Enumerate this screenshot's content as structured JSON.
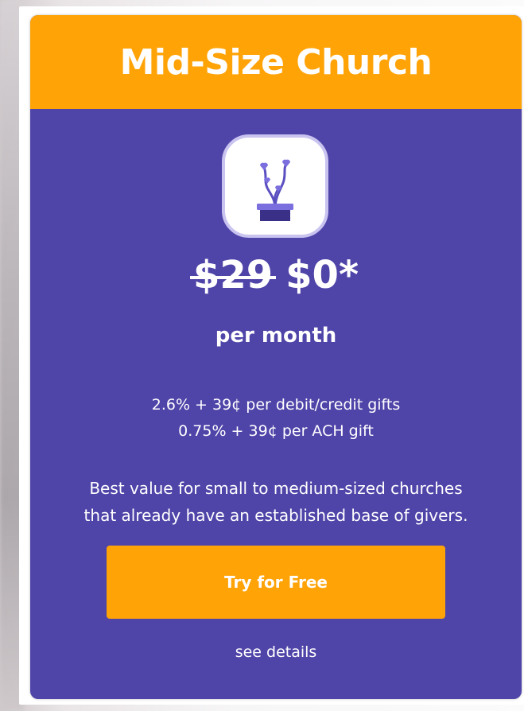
{
  "plan": {
    "title": "Mid-Size Church",
    "icon": "flower-pot-hearts-icon",
    "old_price": "$29",
    "new_price": "$0*",
    "period": "per month",
    "fees": [
      "2.6% + 39¢ per debit/credit gifts",
      "0.75% + 39¢ per ACH gift"
    ],
    "description_lines": [
      "Best value for small to medium-sized churches",
      "that already have an established base of givers."
    ],
    "cta_label": "Try for Free",
    "details_label": "see details"
  },
  "colors": {
    "header": "#ffa307",
    "card": "#4f44a8",
    "button": "#ffa307",
    "icon_accent": "#7b6fe0"
  }
}
